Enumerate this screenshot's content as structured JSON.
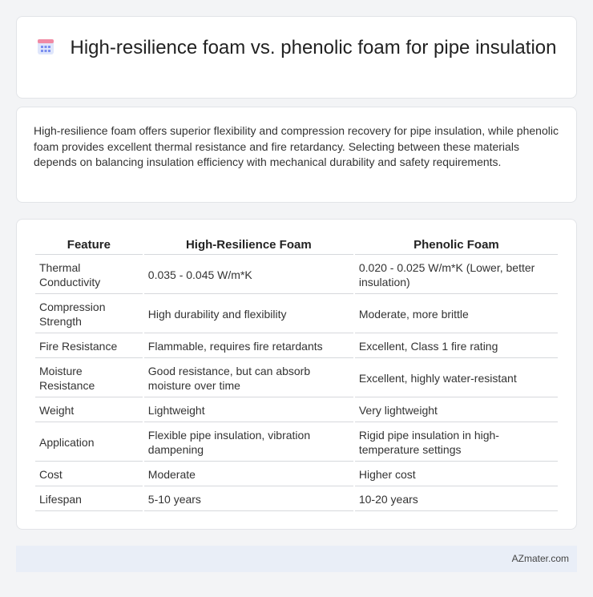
{
  "header": {
    "icon": "calendar-icon",
    "title": "High-resilience foam vs. phenolic foam for pipe insulation"
  },
  "intro": {
    "text": "High-resilience foam offers superior flexibility and compression recovery for pipe insulation, while phenolic foam provides excellent thermal resistance and fire retardancy. Selecting between these materials depends on balancing insulation efficiency with mechanical durability and safety requirements."
  },
  "table": {
    "headers": [
      "Feature",
      "High-Resilience Foam",
      "Phenolic Foam"
    ],
    "rows": [
      [
        "Thermal Conductivity",
        "0.035 - 0.045 W/m*K",
        "0.020 - 0.025 W/m*K (Lower, better insulation)"
      ],
      [
        "Compression Strength",
        "High durability and flexibility",
        "Moderate, more brittle"
      ],
      [
        "Fire Resistance",
        "Flammable, requires fire retardants",
        "Excellent, Class 1 fire rating"
      ],
      [
        "Moisture Resistance",
        "Good resistance, but can absorb moisture over time",
        "Excellent, highly water-resistant"
      ],
      [
        "Weight",
        "Lightweight",
        "Very lightweight"
      ],
      [
        "Application",
        "Flexible pipe insulation, vibration dampening",
        "Rigid pipe insulation in high-temperature settings"
      ],
      [
        "Cost",
        "Moderate",
        "Higher cost"
      ],
      [
        "Lifespan",
        "5-10 years",
        "10-20 years"
      ]
    ]
  },
  "footer": {
    "brand": "AZmater.com"
  },
  "colors": {
    "icon_top": "#f08aa4",
    "icon_body": "#dfe6fb",
    "icon_grid": "#7b8ff0",
    "footer_bg": "#e9eef7"
  }
}
